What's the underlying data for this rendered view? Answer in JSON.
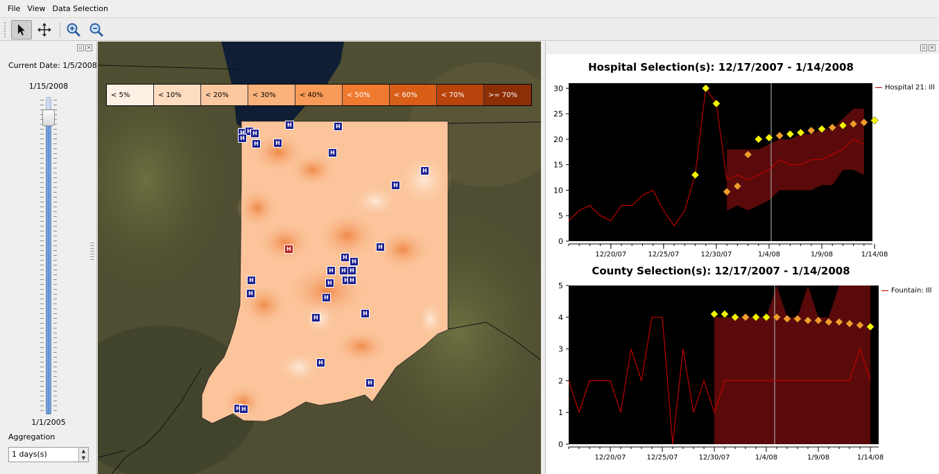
{
  "menu": {
    "file": "File",
    "view": "View",
    "data_selection": "Data Selection"
  },
  "toolbar": {
    "tools": [
      "pointer-icon",
      "pan-icon",
      "zoom-in-icon",
      "zoom-out-icon"
    ]
  },
  "left_panel": {
    "current_date": "Current Date: 1/5/2008",
    "slider_max": "1/15/2008",
    "slider_min": "1/1/2005",
    "slider_position": 0.96,
    "aggregation_label": "Aggregation",
    "aggregation_value": "1 days(s)"
  },
  "map": {
    "legend": [
      "< 5%",
      "< 10%",
      "< 20%",
      "< 30%",
      "< 40%",
      "< 50%",
      "< 60%",
      "< 70%",
      ">= 70%"
    ],
    "legend_colors": [
      "#fdf0e4",
      "#fddcc0",
      "#fcc8a0",
      "#fbb37c",
      "#f89a58",
      "#f07a30",
      "#d85e18",
      "#b8440c",
      "#8c2e06"
    ],
    "hospital_icon_label": "H"
  },
  "chart_data": [
    {
      "type": "line",
      "title": "Hospital Selection(s): 12/17/2007 - 1/14/2008",
      "xlabel": "",
      "ylabel": "",
      "xtick_labels": [
        "12/20/07",
        "12/25/07",
        "12/30/07",
        "1/4/08",
        "1/9/08",
        "1/14/08"
      ],
      "ytick_labels": [
        "0",
        "5",
        "10",
        "15",
        "20",
        "25",
        "30"
      ],
      "ylim": [
        0,
        31
      ],
      "x_start": "12/16/07",
      "x_end": "1/15/08",
      "current_date_marker": "1/5/08",
      "background": "#000000",
      "series": [
        {
          "name": "Hospital 21: Ill",
          "color": "#c00000",
          "values": [
            4,
            6,
            7,
            5,
            4,
            7,
            7,
            9,
            10,
            6,
            3,
            6,
            13,
            30,
            27,
            12,
            13,
            12,
            13,
            14,
            16,
            15,
            15,
            16,
            16,
            17,
            18,
            20,
            19
          ]
        }
      ],
      "band": {
        "start_index": 15,
        "lower": [
          6,
          7,
          6,
          7,
          8,
          10,
          10,
          10,
          10,
          11,
          11,
          14,
          14,
          13
        ],
        "upper": [
          18,
          18,
          18,
          18,
          19,
          20,
          20,
          21,
          21,
          22,
          22,
          24,
          26,
          26
        ]
      },
      "alerts": {
        "start_index": 12,
        "values": [
          13,
          30,
          27,
          9.7,
          10.8,
          17,
          20,
          20.3,
          20.7,
          21,
          21.3,
          21.7,
          22,
          22.3,
          22.7,
          23,
          23.3,
          23.7
        ],
        "kinds": [
          "y",
          "y",
          "y",
          "o",
          "o",
          "o",
          "y",
          "y",
          "o",
          "y",
          "y",
          "o",
          "y",
          "o",
          "y",
          "o",
          "o",
          "y"
        ]
      }
    },
    {
      "type": "line",
      "title": "County Selection(s): 12/17/2007 - 1/14/2008",
      "xlabel": "",
      "ylabel": "",
      "xtick_labels": [
        "12/20/07",
        "12/25/07",
        "12/30/07",
        "1/4/08",
        "1/9/08",
        "1/14/08"
      ],
      "ytick_labels": [
        "0",
        "1",
        "2",
        "3",
        "4",
        "5"
      ],
      "ylim": [
        0,
        5
      ],
      "x_start": "12/16/07",
      "x_end": "1/15/08",
      "current_date_marker": "1/5/08",
      "background": "#000000",
      "series": [
        {
          "name": "Fountain: Ill",
          "color": "#c00000",
          "values": [
            2,
            1,
            2,
            2,
            2,
            1,
            3,
            2,
            4,
            4,
            0,
            3,
            1,
            2,
            1,
            2,
            2,
            2,
            2,
            2,
            2,
            2,
            2,
            2,
            2,
            2,
            2,
            2,
            3,
            2
          ]
        }
      ],
      "band": {
        "start_index": 14,
        "lower": [
          0,
          0,
          0,
          0,
          0,
          0,
          0,
          0,
          0,
          0,
          0,
          0,
          0,
          0,
          0,
          0
        ],
        "upper": [
          4,
          4,
          4,
          4,
          4,
          4,
          5,
          4,
          4,
          5,
          4,
          4,
          5,
          5,
          5,
          5
        ]
      },
      "alerts": {
        "start_index": 14,
        "values": [
          4.1,
          4.1,
          4,
          4,
          4,
          4,
          4,
          3.95,
          3.95,
          3.9,
          3.9,
          3.85,
          3.85,
          3.8,
          3.75,
          3.7
        ],
        "kinds": [
          "y",
          "y",
          "y",
          "o",
          "y",
          "y",
          "o",
          "o",
          "o",
          "o",
          "o",
          "o",
          "o",
          "o",
          "o",
          "y"
        ]
      }
    }
  ]
}
